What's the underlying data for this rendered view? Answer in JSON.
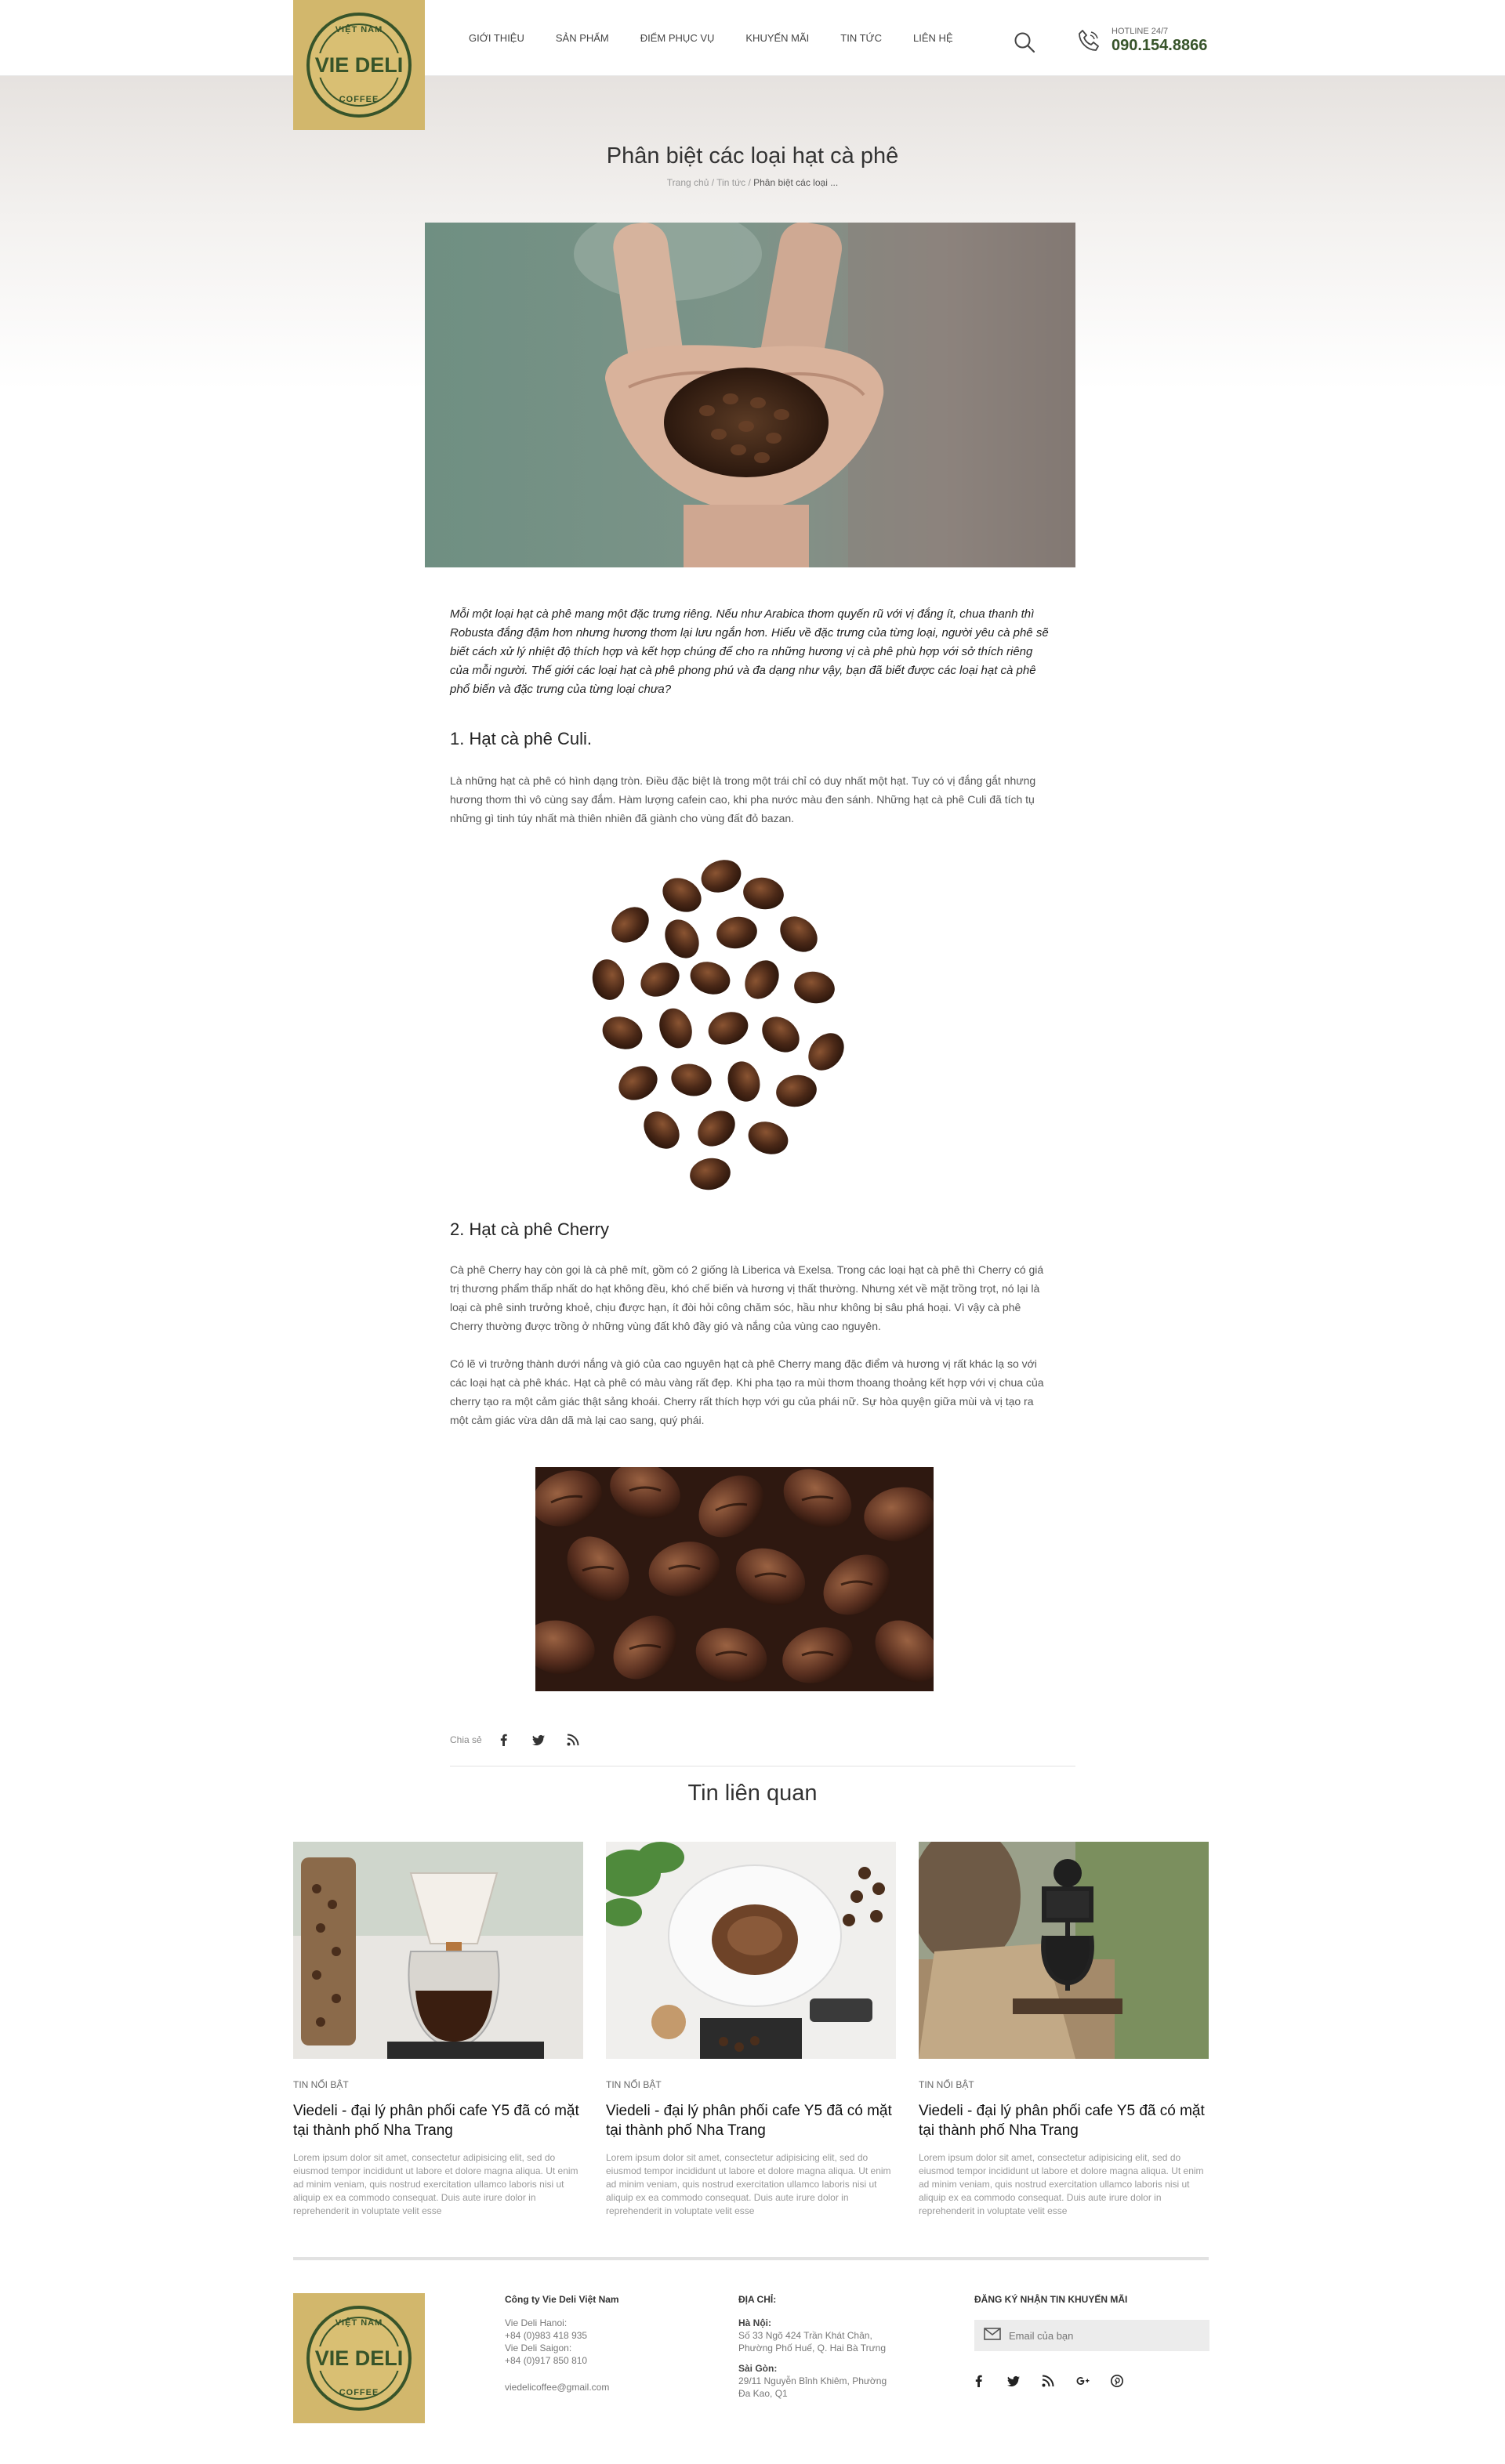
{
  "header": {
    "logo": {
      "top": "VIỆT NAM",
      "main": "VIE DELI",
      "bottom": "COFFEE"
    },
    "nav": [
      "GIỚI THIỆU",
      "SẢN PHẨM",
      "ĐIỂM PHỤC VỤ",
      "KHUYẾN MÃI",
      "TIN TỨC",
      "LIÊN HỆ"
    ],
    "hotline_label": "HOTLINE 24/7",
    "hotline_number": "090.154.8866",
    "icons": {
      "search": "search-icon",
      "phone": "phone-icon"
    }
  },
  "page": {
    "title": "Phân biệt các loại hạt cà phê",
    "breadcrumb": {
      "home": "Trang chủ",
      "sep1": " / ",
      "news": "Tin tức",
      "sep2": " / ",
      "current": "Phân biệt các loại ..."
    }
  },
  "article": {
    "intro": "Mỗi một loại hạt cà phê mang một đặc trưng riêng. Nếu như Arabica thơm quyến rũ với vị đắng ít, chua thanh thì Robusta đắng đậm hơn nhưng hương thơm lại lưu ngắn hơn. Hiểu về đặc trưng của từng loại, người yêu cà phê sẽ biết cách xử lý nhiệt độ thích hợp và kết hợp chúng để cho ra những hương vị cà phê phù hợp với sở thích riêng của mỗi người. Thế giới các loại hạt cà phê phong phú và đa dạng như vậy, bạn đã biết được các loại hạt cà phê phổ biến và đặc trưng của từng loại chưa?",
    "section1_title": "1. Hạt cà phê Culi.",
    "section1_text": "Là những hạt cà phê có hình dạng tròn. Điều đặc biệt là trong một trái chỉ có duy nhất một hạt. Tuy có vị đắng gắt nhưng hương thơm thì vô cùng say đắm. Hàm lượng cafein cao, khi pha nước màu đen sánh. Những hạt cà phê Culi đã tích tụ những gì tinh túy nhất mà thiên nhiên đã giành cho vùng đất đỏ bazan.",
    "section2_title": "2. Hạt cà phê Cherry",
    "section2_text1": "Cà phê Cherry hay còn gọi là cà phê mít, gồm có 2 giống là Liberica và Exelsa. Trong các loại hạt cà phê thì Cherry có giá trị thương phẩm thấp nhất  do hạt không đều, khó chế biến và hương vị thất thường. Nhưng xét về mặt trồng trọt, nó lại là loại cà phê sinh trưởng khoẻ, chịu được hạn, ít đòi hỏi công chăm sóc, hầu như không bị sâu phá hoại. Vì vậy cà phê Cherry thường được trồng ở những vùng đất khô đầy gió và nắng của vùng cao nguyên.",
    "section2_text2": "Có lẽ vì trưởng thành dưới nắng và gió của cao nguyên hạt cà phê Cherry mang đặc điểm và hương vị rất khác lạ so với các loại hạt cà phê khác. Hạt cà phê có màu vàng  rất đẹp. Khi pha tạo ra mùi thơm thoang thoảng kết hợp với vị chua của cherry tạo ra một cảm giác thật sảng khoái. Cherry rất thích hợp với gu của phái nữ. Sự hòa quyện giữa mùi và vị tạo ra một cảm giác vừa dân dã mà lại cao sang, quý phái."
  },
  "share": {
    "label": "Chia sẻ",
    "icons": [
      "facebook-icon",
      "twitter-icon",
      "rss-icon"
    ]
  },
  "related": {
    "title": "Tin liên quan",
    "cards": [
      {
        "category": "TIN NỔI BẬT",
        "title": "Viedeli - đại lý phân phối cafe Y5 đã có mặt tại thành phố Nha Trang",
        "excerpt": "Lorem ipsum dolor sit amet, consectetur adipisicing elit, sed do eiusmod tempor incididunt ut labore et dolore magna aliqua. Ut enim ad minim veniam, quis nostrud exercitation ullamco laboris nisi ut aliquip ex ea commodo consequat. Duis aute irure dolor in reprehenderit in voluptate velit esse"
      },
      {
        "category": "TIN NỔI BẬT",
        "title": "Viedeli - đại lý phân phối cafe Y5 đã có mặt tại thành phố Nha Trang",
        "excerpt": "Lorem ipsum dolor sit amet, consectetur adipisicing elit, sed do eiusmod tempor incididunt ut labore et dolore magna aliqua. Ut enim ad minim veniam, quis nostrud exercitation ullamco laboris nisi ut aliquip ex ea commodo consequat. Duis aute irure dolor in reprehenderit in voluptate velit esse"
      },
      {
        "category": "TIN NỔI BẬT",
        "title": "Viedeli - đại lý phân phối cafe Y5 đã có mặt tại thành phố Nha Trang",
        "excerpt": "Lorem ipsum dolor sit amet, consectetur adipisicing elit, sed do eiusmod tempor incididunt ut labore et dolore magna aliqua. Ut enim ad minim veniam, quis nostrud exercitation ullamco laboris nisi ut aliquip ex ea commodo consequat. Duis aute irure dolor in reprehenderit in voluptate velit esse"
      }
    ]
  },
  "footer": {
    "company": "Công ty Vie Deli Việt Nam",
    "hanoi_label": "Vie Deli Hanoi:",
    "hanoi_phone": "+84 (0)983 418 935",
    "saigon_label": "Vie Deli Saigon:",
    "saigon_phone": "+84 (0)917 850 810",
    "email": "viedelicoffee@gmail.com",
    "address_title": "ĐỊA CHỈ:",
    "hn_city": "Hà Nội:",
    "hn_addr1": "Số 33 Ngõ 424 Trần Khát Chân,",
    "hn_addr2": "Phường Phố Huế, Q. Hai Bà Trưng",
    "sg_city": "Sài Gòn:",
    "sg_addr1": "29/11 Nguyễn Bỉnh Khiêm, Phường",
    "sg_addr2": "Đa Kao, Q1",
    "newsletter_title": "ĐĂNG KÝ NHẬN TIN KHUYẾN MÃI",
    "email_placeholder": "Email của bạn",
    "social_icons": [
      "facebook-icon",
      "twitter-icon",
      "rss-icon",
      "google-plus-icon",
      "pinterest-icon"
    ]
  },
  "colors": {
    "brand_gold": "#d2b76c",
    "brand_green": "#37542a"
  }
}
